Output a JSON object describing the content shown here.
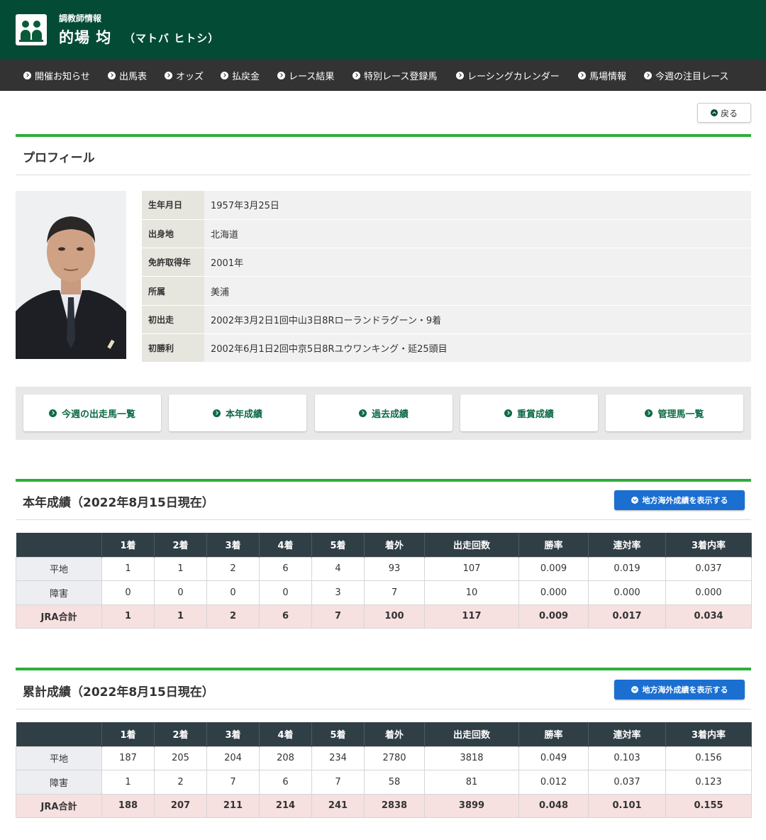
{
  "header": {
    "subtitle": "調教師情報",
    "name": "的場 均",
    "kana": "（マトバ ヒトシ）",
    "bg_color": "#044b35"
  },
  "nav": [
    "開催お知らせ",
    "出馬表",
    "オッズ",
    "払戻金",
    "レース結果",
    "特別レース登録馬",
    "レーシングカレンダー",
    "馬場情報",
    "今週の注目レース"
  ],
  "back_label": "戻る",
  "profile": {
    "title": "プロフィール",
    "rows": [
      {
        "label": "生年月日",
        "value": "1957年3月25日"
      },
      {
        "label": "出身地",
        "value": "北海道"
      },
      {
        "label": "免許取得年",
        "value": "2001年"
      },
      {
        "label": "所属",
        "value": "美浦"
      },
      {
        "label": "初出走",
        "value": "2002年3月2日1回中山3日8Rローランドラグーン・9着"
      },
      {
        "label": "初勝利",
        "value": "2002年6月1日2回中京5日8Rユウワンキング・延25頭目"
      }
    ]
  },
  "links": [
    "今週の出走馬一覧",
    "本年成績",
    "過去成績",
    "重賞成績",
    "管理馬一覧"
  ],
  "accent_color": "#2fae3a",
  "button_label": "地方海外成績を表示する",
  "columns": [
    "",
    "1着",
    "2着",
    "3着",
    "4着",
    "5着",
    "着外",
    "出走回数",
    "勝率",
    "連対率",
    "3着内率"
  ],
  "this_year": {
    "title": "本年成績（2022年8月15日現在）",
    "rows": [
      [
        "平地",
        "1",
        "1",
        "2",
        "6",
        "4",
        "93",
        "107",
        "0.009",
        "0.019",
        "0.037"
      ],
      [
        "障害",
        "0",
        "0",
        "0",
        "0",
        "3",
        "7",
        "10",
        "0.000",
        "0.000",
        "0.000"
      ],
      [
        "JRA合計",
        "1",
        "1",
        "2",
        "6",
        "7",
        "100",
        "117",
        "0.009",
        "0.017",
        "0.034"
      ]
    ]
  },
  "cumulative": {
    "title": "累計成績（2022年8月15日現在）",
    "rows": [
      [
        "平地",
        "187",
        "205",
        "204",
        "208",
        "234",
        "2780",
        "3818",
        "0.049",
        "0.103",
        "0.156"
      ],
      [
        "障害",
        "1",
        "2",
        "7",
        "6",
        "7",
        "58",
        "81",
        "0.012",
        "0.037",
        "0.123"
      ],
      [
        "JRA合計",
        "188",
        "207",
        "211",
        "214",
        "241",
        "2838",
        "3899",
        "0.048",
        "0.101",
        "0.155"
      ]
    ]
  }
}
